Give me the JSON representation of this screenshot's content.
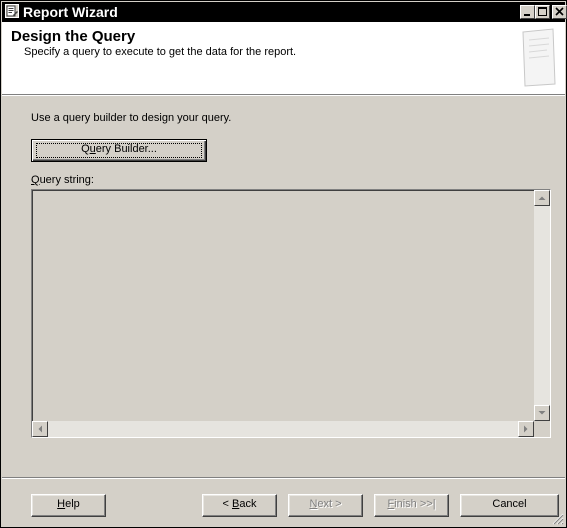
{
  "window": {
    "title": "Report Wizard"
  },
  "header": {
    "title": "Design the Query",
    "subtitle": "Specify a query to execute to get the data for the report."
  },
  "content": {
    "intro": "Use a query builder to design your query.",
    "query_builder_button": {
      "mnemonic": "u",
      "before": "Q",
      "after": "ery Builder..."
    },
    "query_string_label": {
      "mnemonic": "Q",
      "after": "uery string:"
    },
    "query_string_value": ""
  },
  "footer": {
    "help": {
      "mnemonic": "H",
      "after": "elp"
    },
    "back": {
      "before": "< ",
      "mnemonic": "B",
      "after": "ack"
    },
    "next": {
      "mnemonic": "N",
      "after": "ext >",
      "disabled": true
    },
    "finish": {
      "mnemonic": "F",
      "after": "inish >>|",
      "disabled": true
    },
    "cancel": "Cancel"
  },
  "icons": {
    "app": "report-wizard-icon",
    "minimize": "minimize-icon",
    "maximize": "maximize-icon",
    "close": "close-icon",
    "header_graphic": "report-document-graphic",
    "scroll_up": "arrow-up-icon",
    "scroll_down": "arrow-down-icon",
    "scroll_left": "arrow-left-icon",
    "scroll_right": "arrow-right-icon",
    "resize_grip": "resize-grip-icon"
  },
  "colors": {
    "dialog_bg": "#d4d0c8",
    "titlebar_bg": "#000000",
    "header_bg": "#ffffff",
    "disabled_text": "#808080"
  }
}
